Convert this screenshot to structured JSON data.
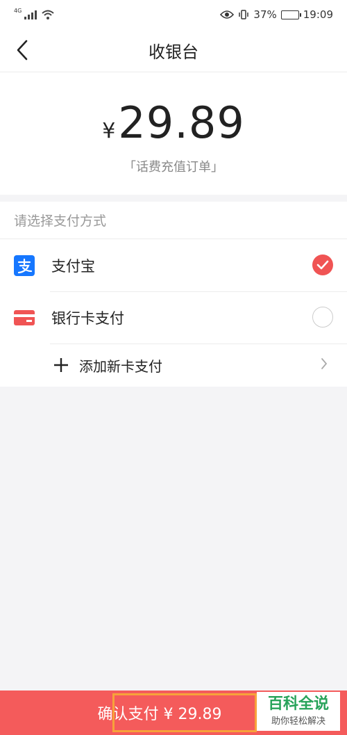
{
  "status_bar": {
    "network": "4G",
    "battery": "37%",
    "time": "19:09"
  },
  "nav": {
    "title": "收银台"
  },
  "amount_panel": {
    "currency": "¥",
    "amount": "29.89",
    "order_desc": "「话费充值订单」"
  },
  "payment": {
    "section_label": "请选择支付方式",
    "methods": [
      {
        "label": "支付宝",
        "icon": "alipay-icon",
        "selected": true
      },
      {
        "label": "银行卡支付",
        "icon": "bank-card-icon",
        "selected": false
      }
    ],
    "add_card_label": "添加新卡支付"
  },
  "footer": {
    "confirm_label": "确认支付 ¥ 29.89"
  },
  "watermark": {
    "title": "百科全说",
    "subtitle": "助你轻松解决"
  },
  "colors": {
    "accent": "#f05454",
    "alipay_blue": "#1677ff",
    "bank_red": "#f05454",
    "highlight": "#f7a23a",
    "watermark_green": "#27a35a"
  }
}
